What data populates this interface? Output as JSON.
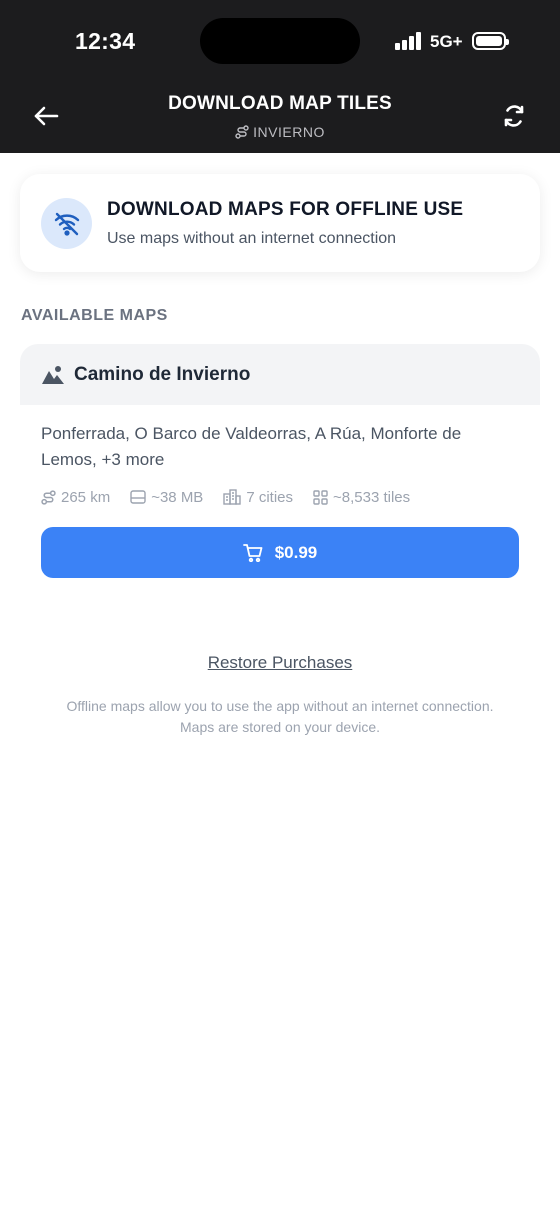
{
  "status_bar": {
    "time": "12:34",
    "network": "5G+"
  },
  "header": {
    "title": "DOWNLOAD MAP TILES",
    "subtitle": "INVIERNO"
  },
  "offline_banner": {
    "title": "DOWNLOAD MAPS FOR OFFLINE USE",
    "subtitle": "Use maps without an internet connection"
  },
  "section_label": "AVAILABLE MAPS",
  "map": {
    "name": "Camino de Invierno",
    "cities": "Ponferrada, O Barco de Valdeorras, A Rúa, Monforte de Lemos, +3 more",
    "stats": {
      "distance": "265 km",
      "size": "~38 MB",
      "cities_count": "7 cities",
      "tiles": "~8,533 tiles"
    },
    "price": "$0.99"
  },
  "restore_label": "Restore Purchases",
  "footnote_line1": "Offline maps allow you to use the app without an internet connection.",
  "footnote_line2": "Maps are stored on your device.",
  "colors": {
    "header_bg": "#1c1c1e",
    "accent": "#3b82f6",
    "icon_bg": "#dbe8fb"
  }
}
